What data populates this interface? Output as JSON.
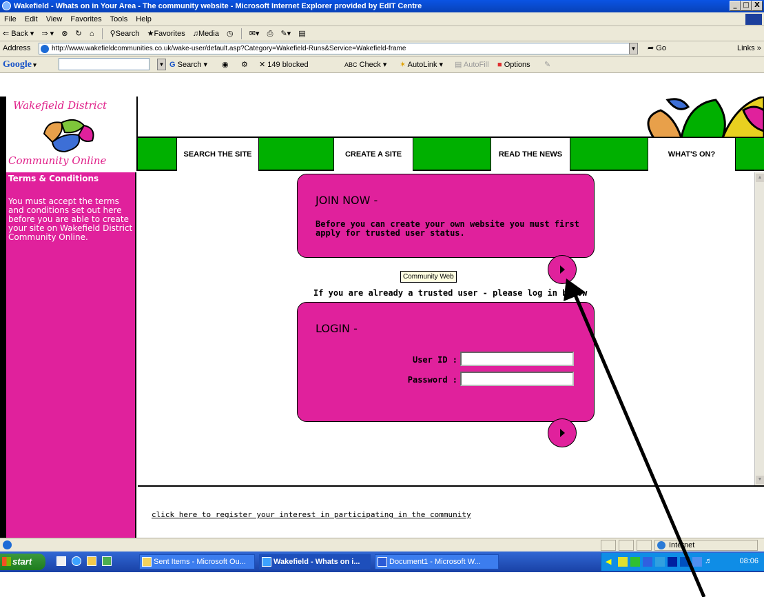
{
  "window": {
    "title": "Wakefield - Whats on in Your Area - The community website - Microsoft Internet Explorer provided by EdIT Centre",
    "controls": [
      "_",
      "□",
      "X"
    ]
  },
  "menubar": [
    "File",
    "Edit",
    "View",
    "Favorites",
    "Tools",
    "Help"
  ],
  "toolbar": {
    "back": "Back",
    "search": "Search",
    "favorites": "Favorites",
    "media": "Media"
  },
  "address": {
    "label": "Address",
    "url": "http://www.wakefieldcommunities.co.uk/wake-user/default.asp?Category=Wakefield-Runs&Service=Wakefield-frame",
    "go": "Go",
    "links": "Links »"
  },
  "google_bar": {
    "logo": "Google",
    "search": "Search",
    "blocked": "149 blocked",
    "check": "Check",
    "autolink": "AutoLink",
    "autofill": "AutoFill",
    "options": "Options"
  },
  "site": {
    "logo_top": "Wakefield District",
    "logo_bottom": "Community Online",
    "nav": [
      "SEARCH THE SITE",
      "CREATE A SITE",
      "READ THE NEWS",
      "WHAT'S ON?"
    ],
    "sidebar_title": "Terms & Conditions",
    "sidebar_text": "You must accept the terms and conditions set out here before you are able to create your site on Wakefield District Community Online.",
    "join_title": "JOIN NOW -",
    "join_text": "Before you can create your own website you must first apply for trusted user status.",
    "tooltip": "Community Web",
    "already_text": "If you are already a trusted user - please log in below",
    "login_title": "LOGIN -",
    "userid_label": "User ID :",
    "password_label": "Password :",
    "register_link": "click here to register your interest in participating in the community"
  },
  "statusbar": {
    "zone": "Internet"
  },
  "taskbar": {
    "start": "start",
    "tasks": [
      {
        "label": "Sent Items - Microsoft Ou...",
        "active": false
      },
      {
        "label": "Wakefield - Whats on i...",
        "active": true
      },
      {
        "label": "Document1 - Microsoft W...",
        "active": false
      }
    ],
    "clock": "08:06"
  },
  "colors": {
    "brand_pink": "#e0219c",
    "nav_green": "#00b000"
  }
}
